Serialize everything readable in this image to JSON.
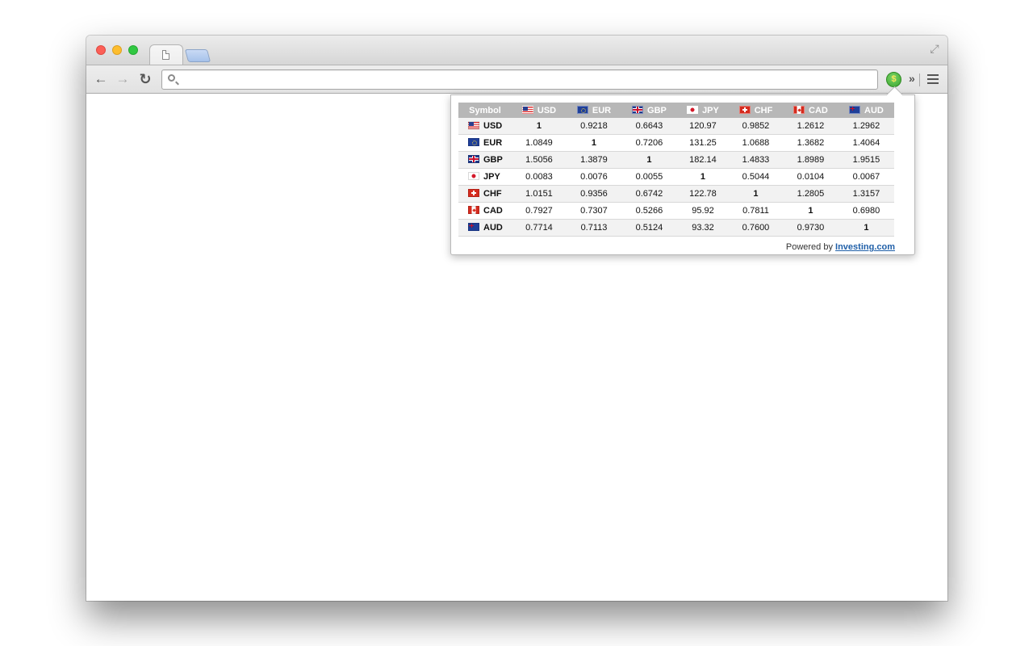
{
  "browser": {
    "address_value": "",
    "address_placeholder": "",
    "extension_icon": "dollar-coin-icon",
    "overflow_chevron": "»"
  },
  "popup": {
    "header": {
      "symbol_label": "Symbol",
      "columns": [
        {
          "code": "USD",
          "flag": "us-flag"
        },
        {
          "code": "EUR",
          "flag": "eu-flag"
        },
        {
          "code": "GBP",
          "flag": "uk-flag"
        },
        {
          "code": "JPY",
          "flag": "japan-flag"
        },
        {
          "code": "CHF",
          "flag": "switzerland-flag"
        },
        {
          "code": "CAD",
          "flag": "canada-flag"
        },
        {
          "code": "AUD",
          "flag": "australia-flag"
        }
      ]
    },
    "rows": [
      {
        "symbol": "USD",
        "values": [
          "1",
          "0.9218",
          "0.6643",
          "120.97",
          "0.9852",
          "1.2612",
          "1.2962"
        ]
      },
      {
        "symbol": "EUR",
        "values": [
          "1.0849",
          "1",
          "0.7206",
          "131.25",
          "1.0688",
          "1.3682",
          "1.4064"
        ]
      },
      {
        "symbol": "GBP",
        "values": [
          "1.5056",
          "1.3879",
          "1",
          "182.14",
          "1.4833",
          "1.8989",
          "1.9515"
        ]
      },
      {
        "symbol": "JPY",
        "values": [
          "0.0083",
          "0.0076",
          "0.0055",
          "1",
          "0.5044",
          "0.0104",
          "0.0067"
        ]
      },
      {
        "symbol": "CHF",
        "values": [
          "1.0151",
          "0.9356",
          "0.6742",
          "122.78",
          "1",
          "1.2805",
          "1.3157"
        ]
      },
      {
        "symbol": "CAD",
        "values": [
          "0.7927",
          "0.7307",
          "0.5266",
          "95.92",
          "0.7811",
          "1",
          "0.6980"
        ]
      },
      {
        "symbol": "AUD",
        "values": [
          "0.7714",
          "0.7113",
          "0.5124",
          "93.32",
          "0.7600",
          "0.9730",
          "1"
        ]
      }
    ],
    "footer": {
      "powered_by": "Powered by",
      "link_text": "Investing.com"
    }
  }
}
